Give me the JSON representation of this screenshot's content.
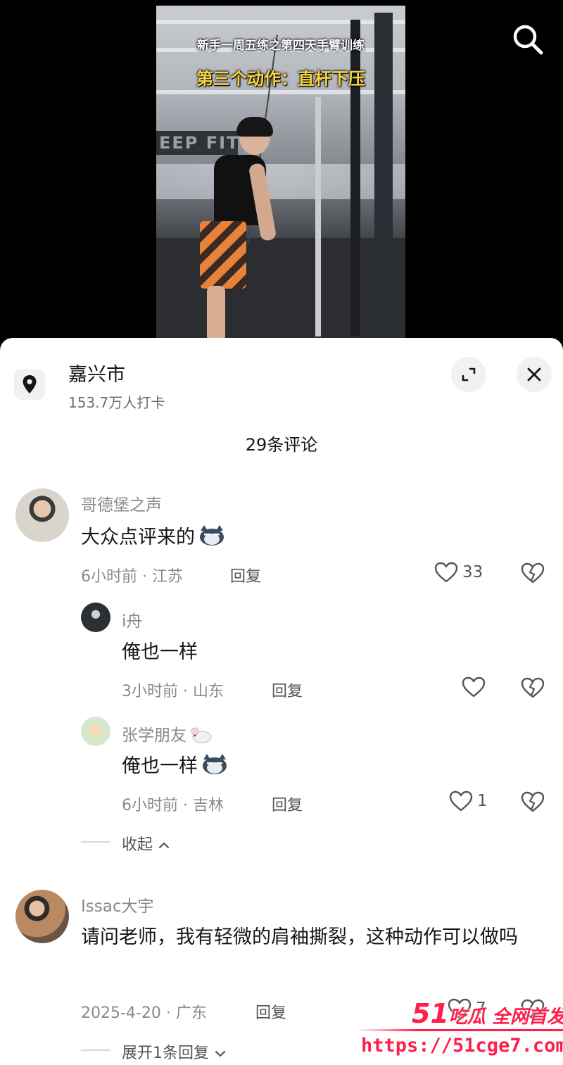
{
  "video": {
    "caption_line1": "新手一周五练之第四天手臂训练",
    "caption_line2": "第三个动作：直杆下压",
    "sign_text": "EEP FIT"
  },
  "location": {
    "name": "嘉兴市",
    "checkins": "153.7万人打卡"
  },
  "comments_header": {
    "count_label": "29条评论"
  },
  "comments": [
    {
      "username": "哥德堡之声",
      "text": "大众点评来的",
      "meta": "6小时前 · 江苏",
      "reply_label": "回复",
      "likes": "33",
      "replies": [
        {
          "username": "i舟",
          "text": "俺也一样",
          "meta": "3小时前 · 山东",
          "reply_label": "回复",
          "likes": ""
        },
        {
          "username": "张学朋友",
          "text": "俺也一样",
          "meta": "6小时前 · 吉林",
          "reply_label": "回复",
          "likes": "1"
        }
      ],
      "collapse_label": "收起"
    },
    {
      "username": "Issac大宇",
      "text": "请问老师，我有轻微的肩袖撕裂，这种动作可以做吗",
      "meta": "2025-4-20 · 广东",
      "reply_label": "回复",
      "likes": "7",
      "expand_label": "展开1条回复"
    }
  ],
  "watermark": {
    "brand_num": "51",
    "brand_text": "吃瓜 全网首发",
    "url": "https://51cge7.com"
  },
  "colors": {
    "sheet_bg": "#ffffff",
    "secondary_text": "#8a8a8e",
    "watermark": "#ff1f4b",
    "caption_yellow": "#f5d342"
  },
  "icons": [
    "search-icon",
    "location-pin-icon",
    "expand-icon",
    "close-icon",
    "heart-icon",
    "broken-heart-icon",
    "chevron-up-icon",
    "chevron-down-icon"
  ]
}
